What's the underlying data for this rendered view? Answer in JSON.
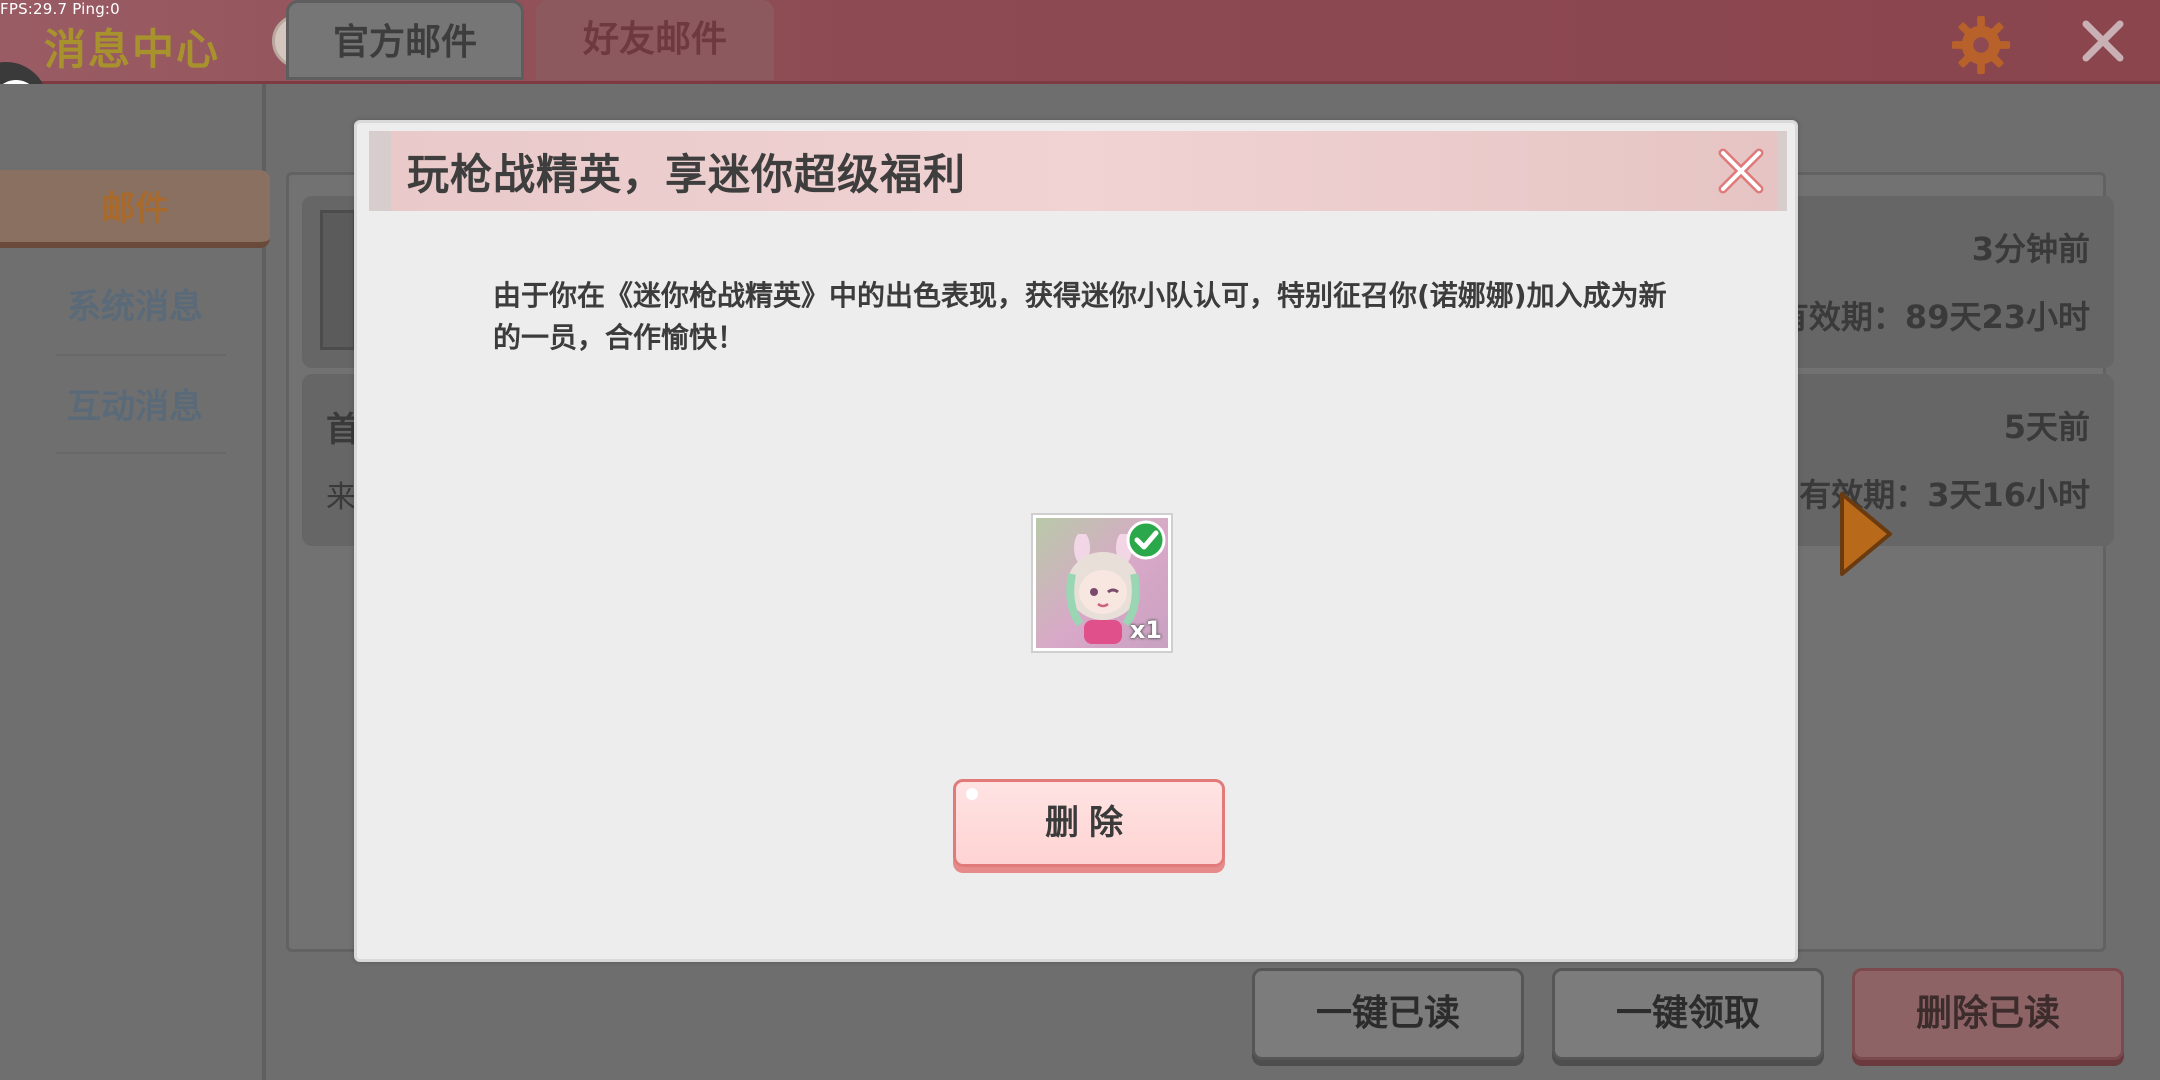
{
  "overlay": {
    "fps_text": "FPS:29.7  Ping:0"
  },
  "header": {
    "title": "消息中心"
  },
  "sidebar": {
    "items": [
      {
        "label": "邮件"
      },
      {
        "label": "系统消息"
      },
      {
        "label": "互动消息"
      }
    ]
  },
  "tabs": [
    {
      "label": "官方邮件"
    },
    {
      "label": "好友邮件"
    }
  ],
  "mails": [
    {
      "title": "",
      "time": "3分钟前",
      "expiry": "有效期：89天23小时"
    },
    {
      "title": "首",
      "subtitle": "来",
      "time": "5天前",
      "expiry": "有效期：3天16小时"
    }
  ],
  "footer": {
    "read_all": "一键已读",
    "claim_all": "一键领取",
    "delete_read": "删除已读"
  },
  "modal": {
    "title": "玩枪战精英，享迷你超级福利",
    "body": "由于你在《迷你枪战精英》中的出色表现，获得迷你小队认可，特别征召你(诺娜娜)加入成为新的一员，合作愉快！",
    "reward": {
      "quantity": "x1",
      "claimed": true
    },
    "delete_label": "删除"
  },
  "colors": {
    "accent": "#e27a7a",
    "header": "#f1d3d3",
    "dim": "#6e6e6e"
  }
}
